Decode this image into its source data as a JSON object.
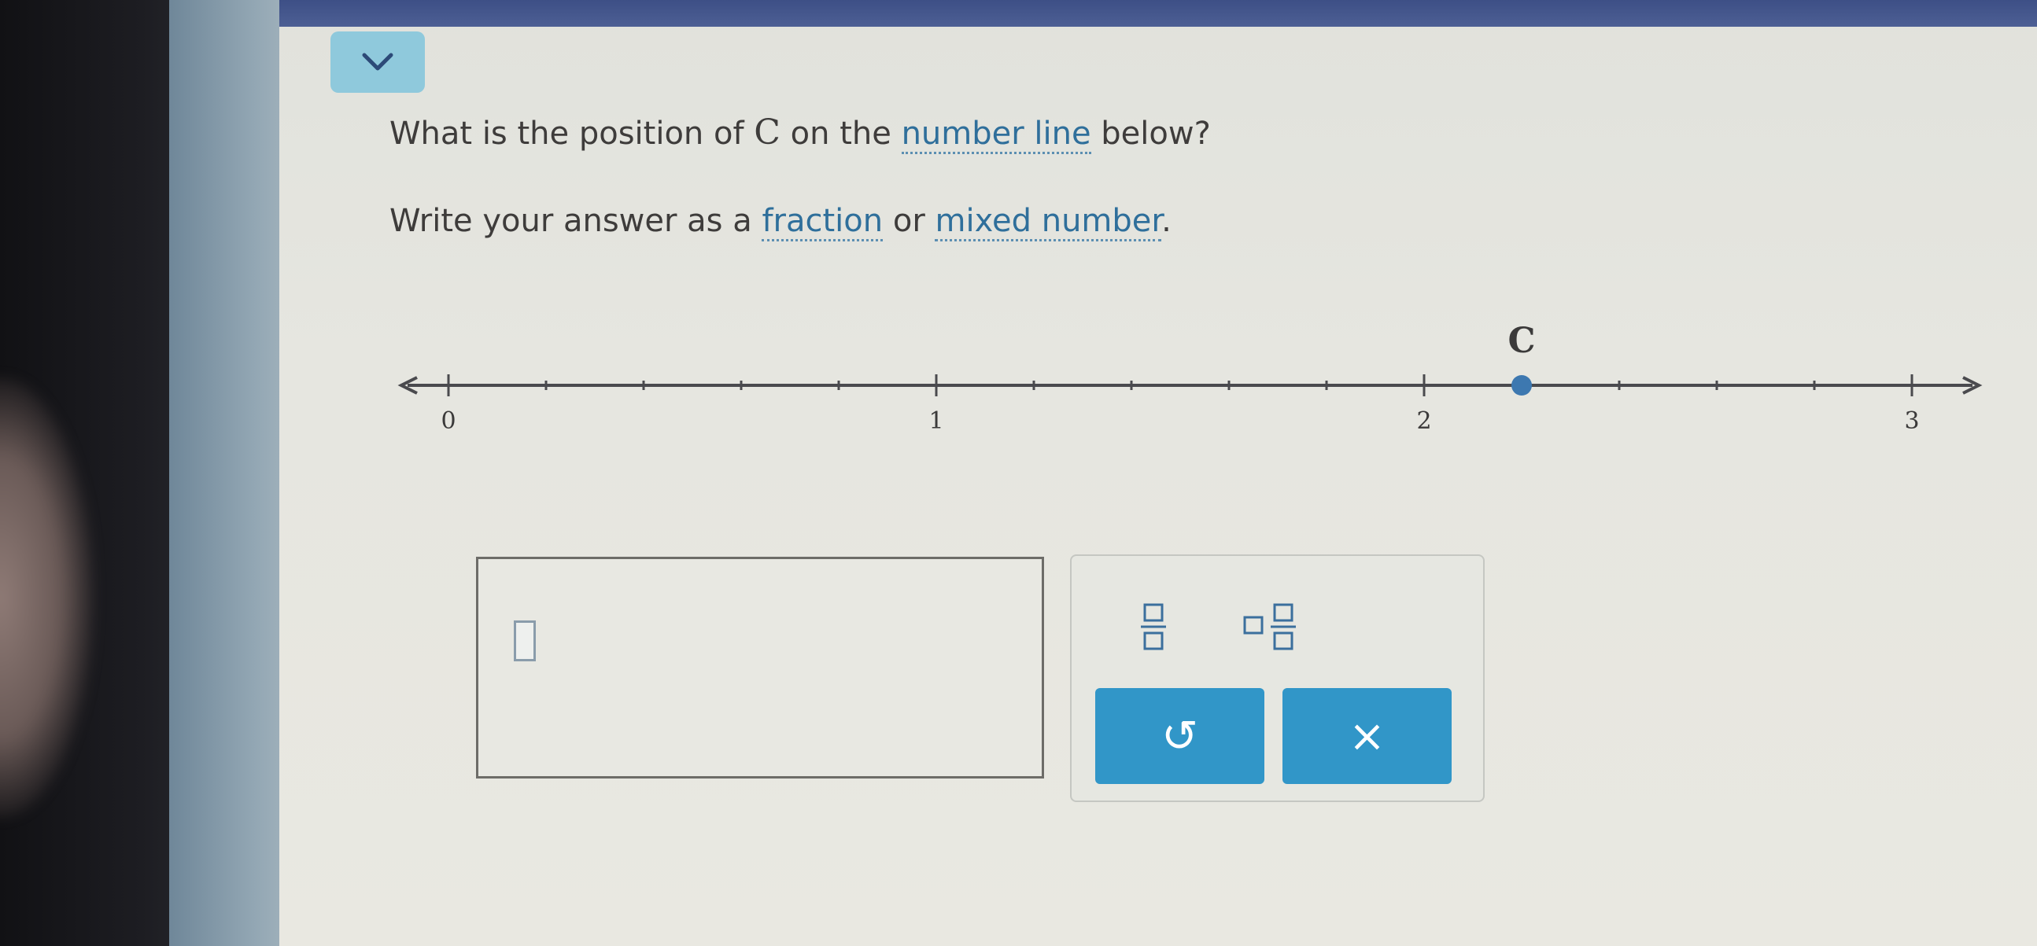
{
  "question": {
    "line1": {
      "prefix": "What is the position of ",
      "variable": "C",
      "middle": " on the ",
      "link": "number line",
      "suffix": " below?"
    },
    "line2": {
      "prefix": "Write your answer as a ",
      "link1": "fraction",
      "middle": " or ",
      "link2": "mixed number",
      "suffix": "."
    }
  },
  "number_line": {
    "min": 0,
    "max": 3,
    "ticks_per_unit": 5,
    "labels": [
      "0",
      "1",
      "2",
      "3"
    ],
    "point": {
      "label": "C",
      "value": 2.2
    },
    "color_point": "#3d78b0"
  },
  "answer": {
    "value": ""
  },
  "keypad": {
    "fraction_icon": "fraction-template-icon",
    "mixed_number_icon": "mixed-number-template-icon",
    "undo_symbol": "↺",
    "clear_symbol": "×"
  },
  "colors": {
    "header_bar": "#3d4f86",
    "tab_bg": "#8fc9dc",
    "link": "#2f6f9b",
    "button_bg": "#3196c8"
  }
}
